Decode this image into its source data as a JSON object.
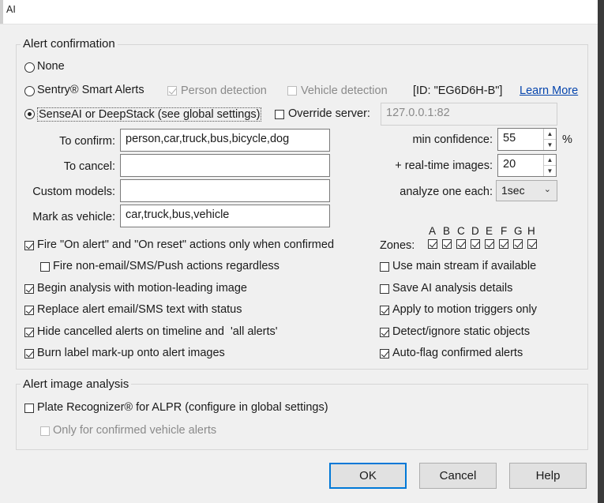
{
  "window": {
    "title": "AI"
  },
  "alert_confirmation": {
    "legend": "Alert confirmation",
    "option_none": "None",
    "option_sentry": "Sentry® Smart Alerts",
    "person_detection": "Person detection",
    "vehicle_detection": "Vehicle detection",
    "sentry_id": "[ID: \"EG6D6H-B\"]",
    "learn_more": "Learn More",
    "option_senseai": "SenseAI or DeepStack (see global settings)",
    "override_server_label": "Override server:",
    "override_server_value": "127.0.0.1:82",
    "to_confirm_label": "To confirm:",
    "to_confirm_value": "person,car,truck,bus,bicycle,dog",
    "to_cancel_label": "To cancel:",
    "to_cancel_value": "",
    "custom_models_label": "Custom models:",
    "custom_models_value": "",
    "mark_vehicle_label": "Mark as vehicle:",
    "mark_vehicle_value": "car,truck,bus,vehicle",
    "min_confidence_label": "min confidence:",
    "min_confidence_value": "55",
    "percent": "%",
    "realtime_images_label": "+ real-time images:",
    "realtime_images_value": "20",
    "analyze_label": "analyze one each:",
    "analyze_value": "1sec",
    "fire_on_alert": "Fire \"On alert\" and \"On reset\" actions only when confirmed",
    "fire_non_email": "Fire non-email/SMS/Push actions regardless",
    "begin_analysis": "Begin analysis with motion-leading image",
    "replace_alert": "Replace alert email/SMS text with status",
    "hide_cancelled": "Hide cancelled alerts on timeline and  'all alerts'",
    "burn_label": "Burn label mark-up onto alert images",
    "zones_label": "Zones:",
    "zones": [
      "A",
      "B",
      "C",
      "D",
      "E",
      "F",
      "G",
      "H"
    ],
    "use_main_stream": "Use main stream if available",
    "save_ai_details": "Save AI analysis details",
    "apply_motion": "Apply to motion triggers only",
    "detect_static": "Detect/ignore static objects",
    "auto_flag": "Auto-flag confirmed alerts"
  },
  "alert_image_analysis": {
    "legend": "Alert image analysis",
    "plate_recognizer": "Plate Recognizer® for ALPR (configure in global settings)",
    "only_confirmed_vehicle": "Only for confirmed vehicle alerts"
  },
  "buttons": {
    "ok": "OK",
    "cancel": "Cancel",
    "help": "Help"
  },
  "icons": {
    "spin_up": "spin-up-icon",
    "spin_down": "spin-down-icon",
    "dropdown": "chevron-down-icon"
  }
}
